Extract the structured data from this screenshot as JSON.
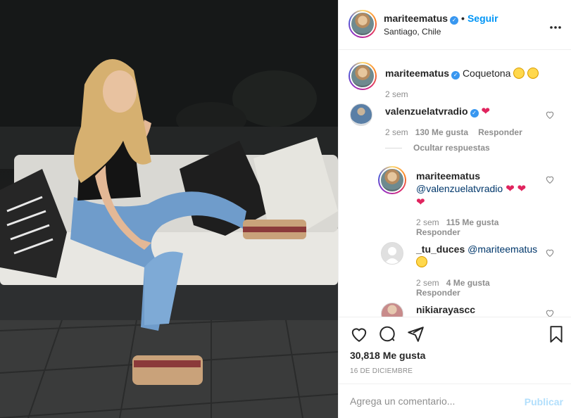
{
  "post": {
    "username": "mariteematus",
    "verified_mark": "✓",
    "separator": "•",
    "follow_label": "Seguir",
    "location": "Santiago, Chile",
    "more_icon": "more-options-icon",
    "photo_alt": "photo"
  },
  "caption": {
    "username": "mariteematus",
    "text": "Coquetona",
    "time": "2 sem"
  },
  "comments": [
    {
      "username": "valenzuelatvradio",
      "heart": "❤",
      "time": "2 sem",
      "likes": "130 Me gusta",
      "reply": "Responder",
      "hide_replies": "Ocultar respuestas"
    }
  ],
  "replies": [
    {
      "username": "mariteematus",
      "mention": "@valenzuelatvradio",
      "time": "2 sem",
      "likes": "115 Me gusta",
      "reply": "Responder"
    },
    {
      "username": "_tu_duces",
      "mention": "@mariteematus",
      "time": "2 sem",
      "likes": "4 Me gusta",
      "reply": "Responder"
    },
    {
      "username": "nikiarayascc"
    }
  ],
  "actions": {
    "likes": "30,818 Me gusta",
    "date": "16 DE DICIEMBRE"
  },
  "comment_box": {
    "placeholder": "Agrega un comentario...",
    "publish_label": "Publicar"
  },
  "colors": {
    "link": "#0095f6",
    "verified": "#3897f0",
    "heart": "#e0245e",
    "publish_disabled": "#b2dffc"
  }
}
